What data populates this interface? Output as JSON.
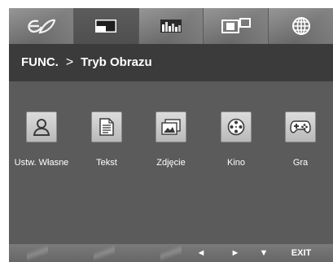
{
  "tabs": [
    {
      "icon": "picture-settings-icon",
      "active": false
    },
    {
      "icon": "picture-mode-icon",
      "active": true
    },
    {
      "icon": "color-adjust-icon",
      "active": false
    },
    {
      "icon": "dual-screen-icon",
      "active": false
    },
    {
      "icon": "language-globe-icon",
      "active": false
    }
  ],
  "header": {
    "menu": "FUNC.",
    "separator": ">",
    "submenu": "Tryb Obrazu"
  },
  "modes": [
    {
      "label": "Ustw. Własne",
      "icon": "user-icon"
    },
    {
      "label": "Tekst",
      "icon": "document-icon"
    },
    {
      "label": "Zdjęcie",
      "icon": "photo-icon"
    },
    {
      "label": "Kino",
      "icon": "film-reel-icon"
    },
    {
      "label": "Gra",
      "icon": "gamepad-icon"
    }
  ],
  "footer": {
    "left": "◄",
    "right": "►",
    "down": "▼",
    "exit": "EXIT"
  }
}
